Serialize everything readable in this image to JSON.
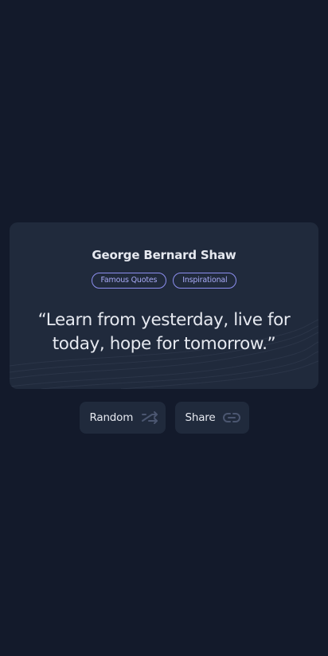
{
  "quote_card": {
    "author": "George Bernard Shaw",
    "tags": [
      "Famous Quotes",
      "Inspirational"
    ],
    "text": "“Learn from yesterday, live for today, hope for tomorrow.”"
  },
  "actions": {
    "random_label": "Random",
    "random_icon": "shuffle-arrows-icon",
    "share_label": "Share",
    "share_icon": "link-icon"
  },
  "colors": {
    "background": "#131a2b",
    "card": "#202a3c",
    "tag_border": "#8d8ff0",
    "text": "#e6e9f0"
  }
}
